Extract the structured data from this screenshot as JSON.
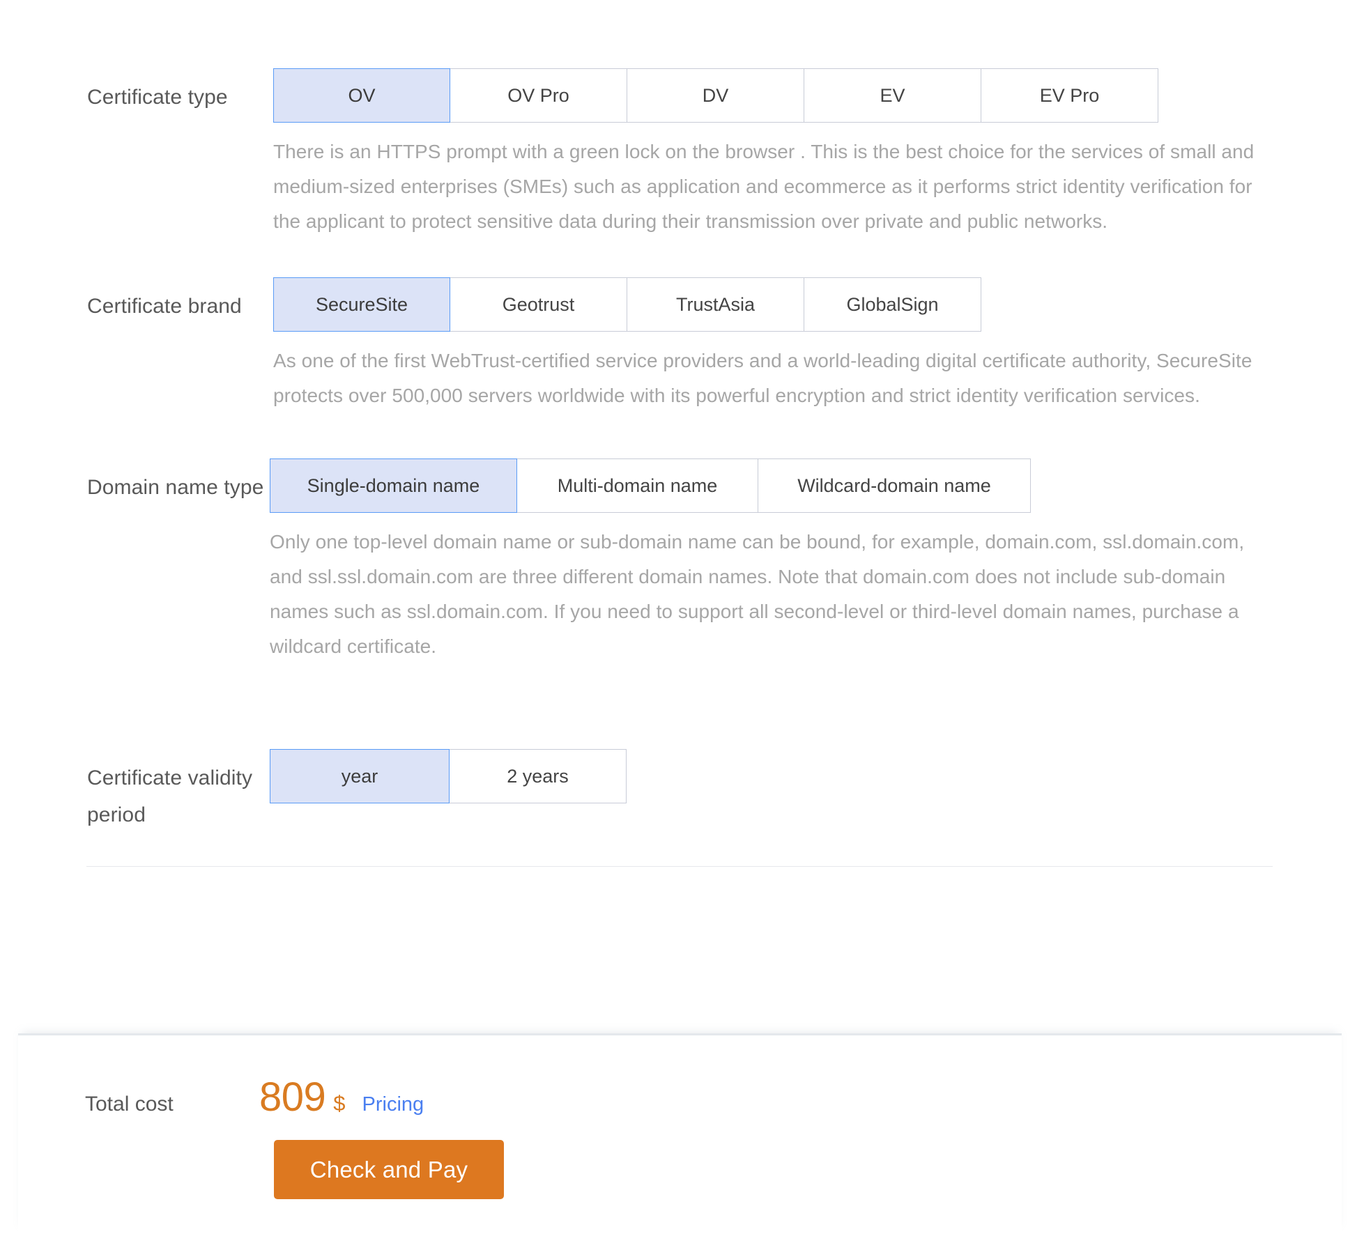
{
  "certificate_type": {
    "label": "Certificate type",
    "options": [
      "OV",
      "OV Pro",
      "DV",
      "EV",
      "EV Pro"
    ],
    "selected": "OV",
    "description": "There is an HTTPS prompt with a green lock on the browser . This is the best choice for the services of small and medium-sized enterprises (SMEs) such as application and ecommerce as it performs strict identity verification for the applicant to protect sensitive data during their transmission over private and public networks."
  },
  "certificate_brand": {
    "label": "Certificate brand",
    "options": [
      "SecureSite",
      "Geotrust",
      "TrustAsia",
      "GlobalSign"
    ],
    "selected": "SecureSite",
    "description": "As one of the first WebTrust-certified service providers and a world-leading digital certificate authority, SecureSite protects over 500,000 servers worldwide with its powerful encryption and strict identity verification services."
  },
  "domain_name_type": {
    "label": "Domain name type",
    "options": [
      "Single-domain name",
      "Multi-domain name",
      "Wildcard-domain name"
    ],
    "selected": "Single-domain name",
    "description": "Only one top-level domain name or sub-domain name can be bound, for example, domain.com, ssl.domain.com, and ssl.ssl.domain.com are three different domain names. Note that domain.com does not include sub-domain names such as ssl.domain.com. If you need to support all second-level or third-level domain names, purchase a wildcard certificate."
  },
  "validity_period": {
    "label": "Certificate validity period",
    "options": [
      "year",
      "2 years"
    ],
    "selected": "year"
  },
  "footer": {
    "total_label": "Total cost",
    "price": "809",
    "currency": "$",
    "pricing_link": "Pricing",
    "pay_button": "Check and Pay"
  },
  "colors": {
    "selected_fill": "#dce3f7",
    "selected_border": "#5a9bf6",
    "price": "#d97b21",
    "link": "#4a7ff0",
    "pay_button": "#dd7820",
    "border": "#c8ccd7",
    "label_text": "#595959",
    "help_text": "#a6a6a6"
  }
}
